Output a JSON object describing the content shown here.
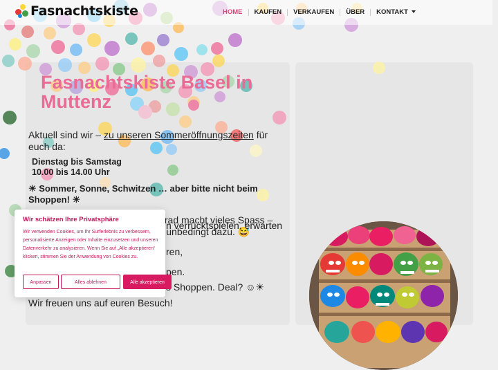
{
  "brand": {
    "name": "Fasnachtskiste"
  },
  "nav": {
    "items": [
      "HOME",
      "KAUFEN",
      "VERKAUFEN",
      "ÜBER",
      "KONTAKT"
    ],
    "active": "HOME"
  },
  "main": {
    "title": "Fasnachtskiste Basel in Muttenz",
    "intro_before": "Aktuell sind wir – ",
    "intro_link": "zu unseren Sommeröffnungszeiten",
    "intro_after": " für euch da:",
    "hours_days": "Dienstag bis Samstag",
    "hours_time": "10.00 bis 14.00 Uhr",
    "sun_line": "☀  Sommer, Sonne, Schwitzen … aber bitte nicht beim Shoppen! ☀",
    "heat_text": "Wir haben festgestellt: Bei 35 Grad macht vieles Spass – Fasnacht-Shoppen gehört nicht unbedingt dazu. 😅",
    "frag_1": "n verrücktspielen, erwarten",
    "frag_2": "ren,",
    "frag_3": "pen.",
    "frag_4": "s Shoppen. Deal? ☺☀",
    "closing": "Wir freuen uns auf euren Besuch!"
  },
  "cookie": {
    "title": "Wir schätzen Ihre Privatsphäre",
    "text": "Wir verwenden Cookies, um Ihr Surferlebnis zu verbessern, personalisierte Anzeigen oder Inhalte einzusetzen und unseren Datenverkehr zu analysieren. Wenn Sie auf „Alle akzeptieren“ klicken, stimmen Sie der Anwendung von Cookies zu.",
    "customize": "Anpassen",
    "reject": "Alles ablehnen",
    "accept": "Alle akzeptieren"
  },
  "colors": {
    "accent": "#e0417a",
    "title_pink": "#ea6b95",
    "cookie_pink": "#c2185b",
    "cookie_button": "#d81b60"
  }
}
